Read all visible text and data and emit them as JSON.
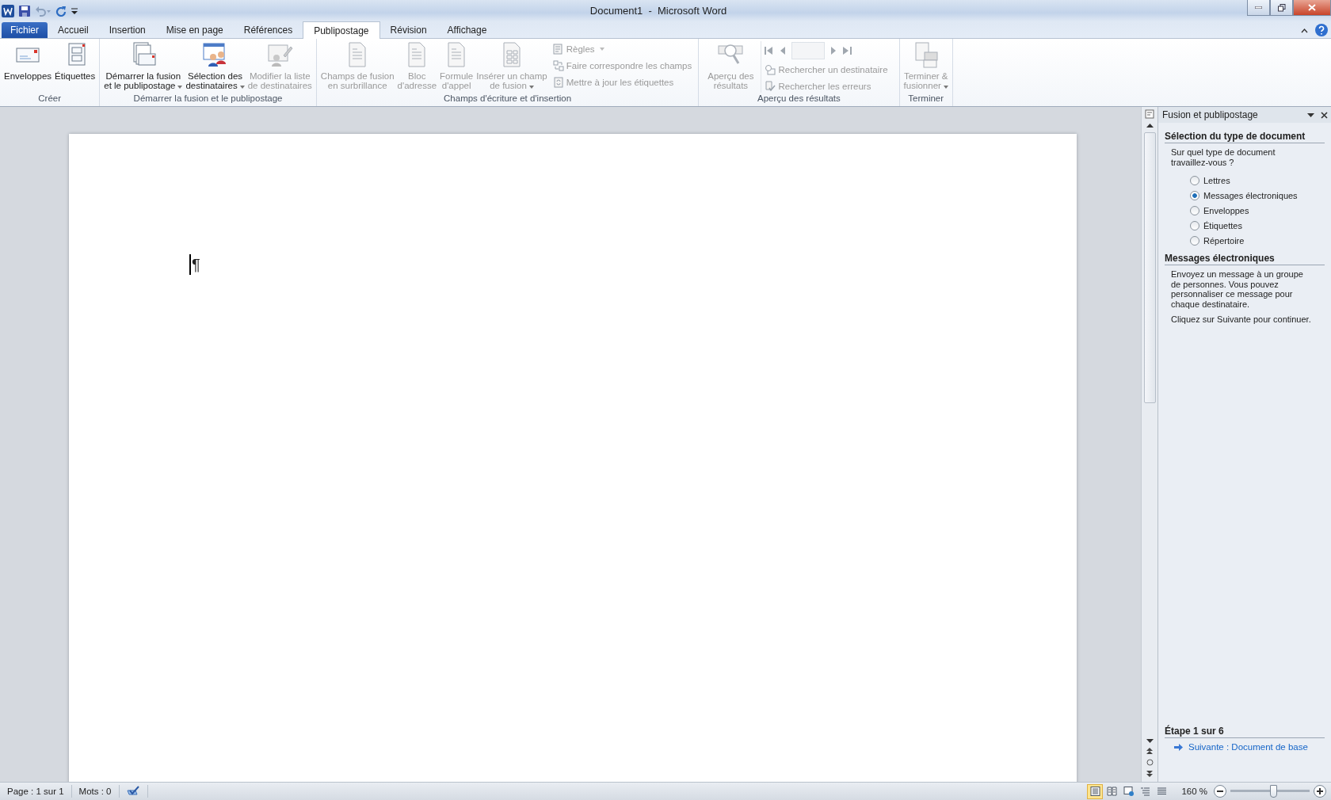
{
  "window": {
    "title": "Document1  -  Microsoft Word"
  },
  "tabs": [
    {
      "label": "Fichier",
      "kind": "file",
      "selected": false
    },
    {
      "label": "Accueil",
      "kind": "normal",
      "selected": false
    },
    {
      "label": "Insertion",
      "kind": "normal",
      "selected": false
    },
    {
      "label": "Mise en page",
      "kind": "normal",
      "selected": false
    },
    {
      "label": "Références",
      "kind": "normal",
      "selected": false
    },
    {
      "label": "Publipostage",
      "kind": "normal",
      "selected": true
    },
    {
      "label": "Révision",
      "kind": "normal",
      "selected": false
    },
    {
      "label": "Affichage",
      "kind": "normal",
      "selected": false
    }
  ],
  "ribbon": {
    "groups": [
      {
        "label": "Créer",
        "items": [
          {
            "kind": "large",
            "lines": [
              "Enveloppes"
            ],
            "disabled": false,
            "dropdown": false
          },
          {
            "kind": "large",
            "lines": [
              "Étiquettes"
            ],
            "disabled": false,
            "dropdown": false
          }
        ]
      },
      {
        "label": "Démarrer la fusion et le publipostage",
        "items": [
          {
            "kind": "large",
            "lines": [
              "Démarrer la fusion",
              "et le publipostage"
            ],
            "disabled": false,
            "dropdown": true
          },
          {
            "kind": "large",
            "lines": [
              "Sélection des",
              "destinataires"
            ],
            "disabled": false,
            "dropdown": true
          },
          {
            "kind": "large",
            "lines": [
              "Modifier la liste",
              "de destinataires"
            ],
            "disabled": true,
            "dropdown": false
          }
        ]
      },
      {
        "label": "Champs d'écriture et d'insertion",
        "items": [
          {
            "kind": "large",
            "lines": [
              "Champs de fusion",
              "en surbrillance"
            ],
            "disabled": true,
            "dropdown": false
          },
          {
            "kind": "large",
            "lines": [
              "Bloc",
              "d'adresse"
            ],
            "disabled": true,
            "dropdown": false
          },
          {
            "kind": "large",
            "lines": [
              "Formule",
              "d'appel"
            ],
            "disabled": true,
            "dropdown": false
          },
          {
            "kind": "large",
            "lines": [
              "Insérer un champ",
              "de fusion"
            ],
            "disabled": true,
            "dropdown": true
          },
          {
            "kind": "small",
            "lines": [
              "Règles"
            ],
            "disabled": true,
            "dropdown": true
          },
          {
            "kind": "small",
            "lines": [
              "Faire correspondre les champs"
            ],
            "disabled": true,
            "dropdown": false
          },
          {
            "kind": "small",
            "lines": [
              "Mettre à jour les étiquettes"
            ],
            "disabled": true,
            "dropdown": false
          }
        ]
      },
      {
        "label": "Aperçu des résultats",
        "items": [
          {
            "kind": "large",
            "lines": [
              "Aperçu des",
              "résultats"
            ],
            "disabled": true,
            "dropdown": false
          },
          {
            "kind": "nav",
            "disabled": true
          },
          {
            "kind": "small",
            "lines": [
              "Rechercher un destinataire"
            ],
            "disabled": true,
            "dropdown": false
          },
          {
            "kind": "small",
            "lines": [
              "Rechercher les erreurs"
            ],
            "disabled": true,
            "dropdown": false
          }
        ]
      },
      {
        "label": "Terminer",
        "items": [
          {
            "kind": "large",
            "lines": [
              "Terminer &",
              "fusionner"
            ],
            "disabled": true,
            "dropdown": true
          }
        ]
      }
    ]
  },
  "document": {
    "paragraph_mark": "¶"
  },
  "task_pane": {
    "title": "Fusion et publipostage",
    "sections": [
      {
        "heading": "Sélection du type de document",
        "question": "Sur quel type de document travaillez-vous ?",
        "options": [
          {
            "label": "Lettres",
            "selected": false
          },
          {
            "label": "Messages électroniques",
            "selected": true
          },
          {
            "label": "Enveloppes",
            "selected": false
          },
          {
            "label": "Étiquettes",
            "selected": false
          },
          {
            "label": "Répertoire",
            "selected": false
          }
        ]
      },
      {
        "heading": "Messages électroniques",
        "paragraphs": [
          "Envoyez un message à un groupe de personnes. Vous pouvez personnaliser ce message pour chaque destinataire.",
          "Cliquez sur Suivante pour continuer."
        ]
      }
    ],
    "step": {
      "heading": "Étape 1 sur 6",
      "link": "Suivante : Document de base"
    }
  },
  "status_bar": {
    "page": "Page : 1 sur 1",
    "words": "Mots : 0",
    "views": [
      {
        "kind": "print",
        "selected": true
      },
      {
        "kind": "reading",
        "selected": false
      },
      {
        "kind": "web",
        "selected": false
      },
      {
        "kind": "outline",
        "selected": false
      },
      {
        "kind": "draft",
        "selected": false
      }
    ],
    "zoom": "160 %",
    "zoom_slider": {
      "level": 0.55
    }
  }
}
